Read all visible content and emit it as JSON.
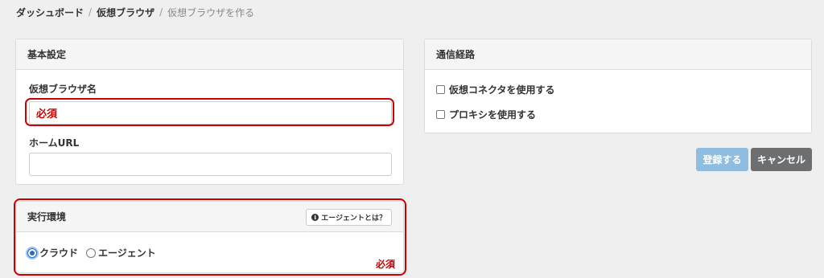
{
  "breadcrumb": {
    "items": [
      "ダッシュボード",
      "仮想ブラウザ"
    ],
    "separator": "/",
    "current": "仮想ブラウザを作る"
  },
  "basic_settings": {
    "header": "基本設定",
    "browser_name": {
      "label": "仮想ブラウザ名",
      "value": "",
      "required_note": "必須"
    },
    "home_url": {
      "label": "ホームURL",
      "value": ""
    }
  },
  "route": {
    "header": "通信経路",
    "options": [
      {
        "label": "仮想コネクタを使用する",
        "checked": false
      },
      {
        "label": "プロキシを使用する",
        "checked": false
      }
    ]
  },
  "actions": {
    "register_label": "登録する",
    "cancel_label": "キャンセル"
  },
  "exec_env": {
    "header": "実行環境",
    "help_label": "エージェントとは？",
    "options": [
      {
        "label": "クラウド",
        "selected": true
      },
      {
        "label": "エージェント",
        "selected": false
      }
    ],
    "required_note": "必須"
  },
  "colors": {
    "highlight": "#cc0000",
    "register_button": "#8fbde0",
    "cancel_button": "#6d6e70",
    "radio_selected": "#2a6ebb"
  },
  "icons": [
    "info-icon"
  ]
}
